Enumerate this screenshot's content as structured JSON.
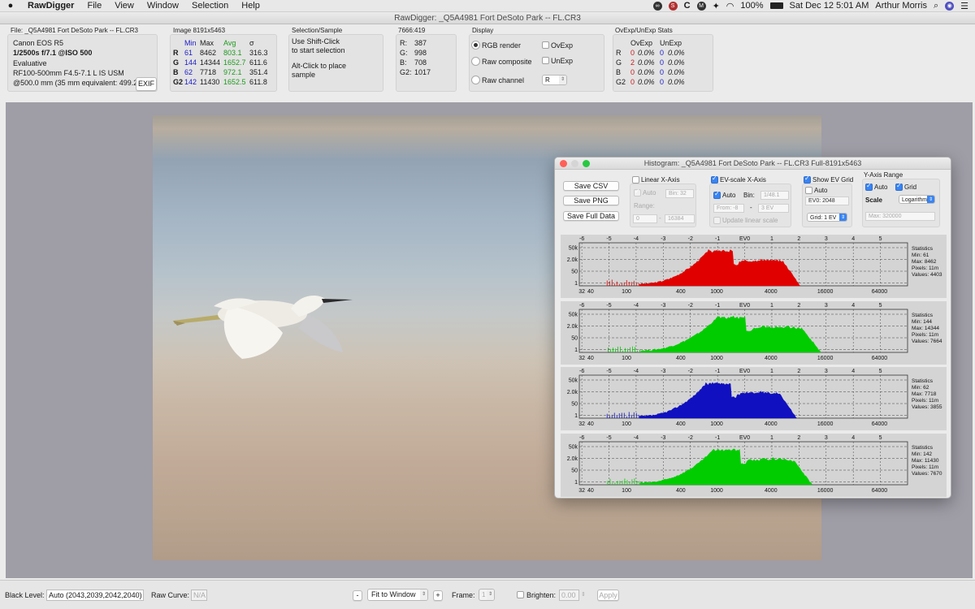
{
  "menubar": {
    "app_name": "RawDigger",
    "menus": [
      "File",
      "View",
      "Window",
      "Selection",
      "Help"
    ],
    "battery": "100%",
    "clock": "Sat Dec 12  5:01 AM",
    "user": "Arthur Morris"
  },
  "window_title": "RawDigger: _Q5A4981 Fort DeSoto Park  -- FL.CR3",
  "file_panel": {
    "title": "File: _Q5A4981 Fort DeSoto Park  -- FL.CR3",
    "camera": "Canon EOS R5",
    "exposure": "1/2500s f/7.1 @ISO 500",
    "metering": "Evaluative",
    "lens": "RF100-500mm F4.5-7.1 L IS USM",
    "focal": "@500.0 mm (35 mm equivalent: 499.2",
    "exif_button": "EXIF"
  },
  "image_panel": {
    "title": "Image 8191x5463",
    "headers": [
      "Min",
      "Max",
      "Avg",
      "σ"
    ],
    "rows": [
      {
        "ch": "R",
        "min": "61",
        "max": "8462",
        "avg": "803.1",
        "sd": "316.3"
      },
      {
        "ch": "G",
        "min": "144",
        "max": "14344",
        "avg": "1652.7",
        "sd": "611.6"
      },
      {
        "ch": "B",
        "min": "62",
        "max": "7718",
        "avg": "972.1",
        "sd": "351.4"
      },
      {
        "ch": "G2",
        "min": "142",
        "max": "11430",
        "avg": "1652.5",
        "sd": "611.8"
      }
    ]
  },
  "selection_panel": {
    "title": "Selection/Sample",
    "line1": "Use Shift-Click",
    "line2": "to start selection",
    "line3": "Alt-Click to place",
    "line4": "sample"
  },
  "pixel_panel": {
    "title": "7666:419",
    "rows": [
      {
        "label": "R:",
        "value": "387"
      },
      {
        "label": "G:",
        "value": "998"
      },
      {
        "label": "B:",
        "value": "708"
      },
      {
        "label": "G2:",
        "value": "1017"
      }
    ]
  },
  "display_panel": {
    "title": "Display",
    "rgb_render": "RGB render",
    "raw_composite": "Raw composite",
    "raw_channel": "Raw channel",
    "ovexp": "OvExp",
    "unexp": "UnExp",
    "channel_value": "R"
  },
  "stats_panel": {
    "title": "OvExp/UnExp Stats",
    "headers": [
      "OvExp",
      "UnExp"
    ],
    "rows": [
      {
        "ch": "R",
        "ov_n": "0",
        "ov_p": "0.0%",
        "un_n": "0",
        "un_p": "0.0%"
      },
      {
        "ch": "G",
        "ov_n": "2",
        "ov_p": "0.0%",
        "un_n": "0",
        "un_p": "0.0%"
      },
      {
        "ch": "B",
        "ov_n": "0",
        "ov_p": "0.0%",
        "un_n": "0",
        "un_p": "0.0%"
      },
      {
        "ch": "G2",
        "ov_n": "0",
        "ov_p": "0.0%",
        "un_n": "0",
        "un_p": "0.0%"
      }
    ]
  },
  "histogram": {
    "title": "Histogram: _Q5A4981 Fort DeSoto Park  -- FL.CR3 Full-8191x5463",
    "save_csv": "Save CSV",
    "save_png": "Save PNG",
    "save_full": "Save Full Data",
    "linear_x": "Linear X-Axis",
    "auto": "Auto",
    "bin_value": "Bin: 32",
    "range": "Range:",
    "range_from": "0",
    "range_to": "16384",
    "ev_scale": "EV-scale X-Axis",
    "bin_label": "Bin:",
    "ev_bin": "1/48.1",
    "from_ev": "From: -8",
    "to_ev": "3 EV",
    "update_linear": "Update linear scale",
    "show_ev_grid": "Show EV Grid",
    "ev0": "EV0: 2048",
    "grid": "Grid: 1 EV",
    "y_axis_range": "Y-Axis Range",
    "grid_label": "Grid",
    "scale": "Scale",
    "scale_value": "Logarithm",
    "max_value": "Max: 320000",
    "ev_ticks": [
      "-6",
      "-5",
      "-4",
      "-3",
      "-2",
      "-1",
      "EV0",
      "1",
      "2",
      "3",
      "4",
      "5"
    ],
    "x_ticks": [
      "32",
      "40",
      "100",
      "400",
      "1000",
      "4000",
      "16000",
      "64000"
    ],
    "y_ticks": [
      "50k",
      "2.0k",
      "50",
      "1"
    ],
    "stats_label": "Statistics",
    "channels": [
      {
        "name": "R",
        "color": "#e00000",
        "min": "Min: 61",
        "max": "Max: 8462",
        "pixels": "Pixels: 11m",
        "values": "Values: 4403"
      },
      {
        "name": "G",
        "color": "#00cc00",
        "min": "Min: 144",
        "max": "Max: 14344",
        "pixels": "Pixels: 11m",
        "values": "Values: 7664"
      },
      {
        "name": "B",
        "color": "#1010c0",
        "min": "Min: 62",
        "max": "Max: 7718",
        "pixels": "Pixels: 11m",
        "values": "Values: 3855"
      },
      {
        "name": "G2",
        "color": "#00cc00",
        "min": "Min: 142",
        "max": "Max: 11430",
        "pixels": "Pixels: 11m",
        "values": "Values: 7670"
      }
    ]
  },
  "bottombar": {
    "black_level_label": "Black Level:",
    "black_level": "Auto (2043,2039,2042,2040)",
    "raw_curve_label": "Raw Curve:",
    "raw_curve": "N/A",
    "zoom_minus": "-",
    "zoom_value": "Fit to Window",
    "zoom_plus": "+",
    "frame_label": "Frame:",
    "frame_value": "1",
    "brighten_label": "Brighten:",
    "brighten_value": "0.00",
    "apply": "Apply"
  }
}
